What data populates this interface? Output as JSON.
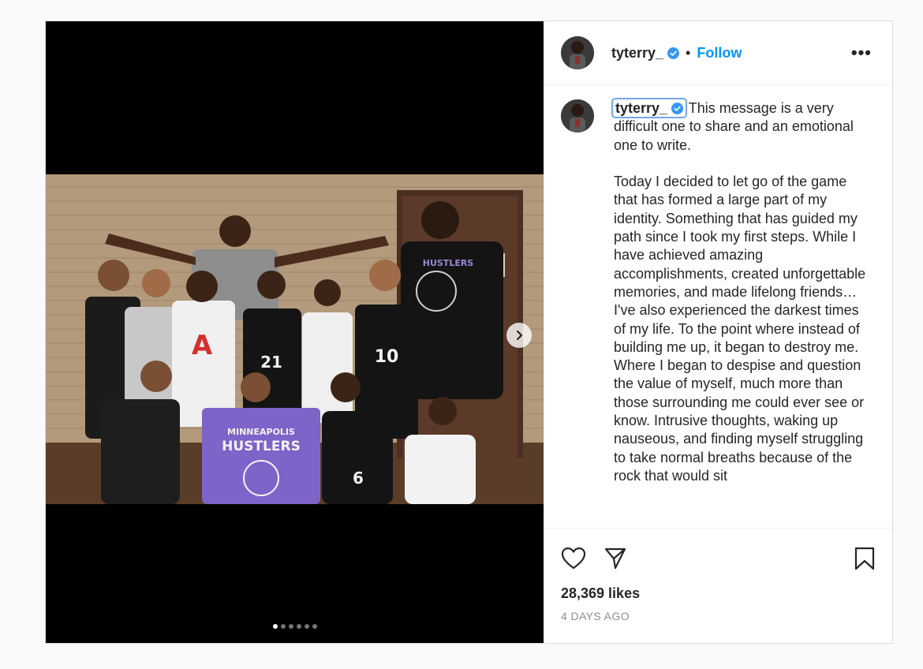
{
  "post": {
    "username": "tyterry_",
    "follow_label": "Follow",
    "separator": "•",
    "more_label": "•••",
    "caption": " This message is a very difficult one to share and an emotional one to write.\n\nToday I decided to let go of the game that has formed a large part of my identity. Something that has guided my path since I took my first steps. While I have achieved amazing accomplishments, created unforgettable memories, and made lifelong friends…I've also experienced the darkest times of my life. To the point where instead of building me up, it began to destroy me. Where I began to despise and question the value of myself, much more than those surrounding me could ever see or know. Intrusive thoughts, waking up nauseous, and finding myself struggling to take normal breaths because of the rock that would sit",
    "likes": "28,369 likes",
    "timestamp": "4 DAYS AGO",
    "carousel": {
      "count": 6,
      "active_index": 0
    }
  },
  "jersey_text": {
    "team_line1": "MINNEAPOLIS",
    "team_line2": "HUSTLERS",
    "numbers": [
      "21",
      "10",
      "6"
    ]
  },
  "colors": {
    "accent": "#0095f6",
    "verified": "#3897f0",
    "highlight": "#74a7e8"
  },
  "icons": {
    "like": "heart-icon",
    "share": "paper-plane-icon",
    "save": "bookmark-icon",
    "next": "chevron-right-icon",
    "verified": "verified-badge-icon"
  }
}
